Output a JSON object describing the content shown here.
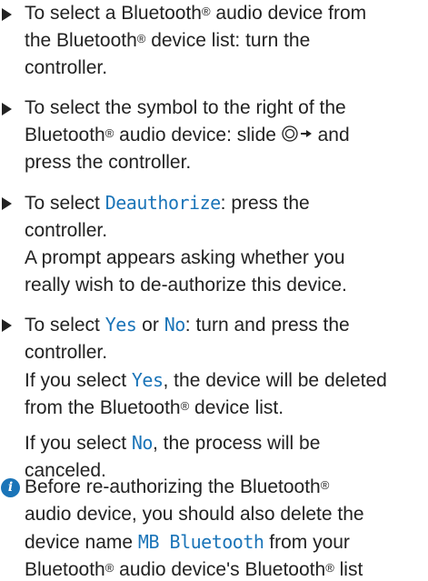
{
  "colors": {
    "text": "#222222",
    "highlight": "#1a74b8"
  },
  "icons": {
    "step_marker": "triangle-right-icon",
    "controller_slide": "controller-slide-right-icon",
    "info": "info-icon"
  },
  "steps": [
    {
      "lines": [
        [
          "To select a Bluetooth",
          "®",
          " audio device from"
        ],
        [
          "the Bluetooth",
          "®",
          " device list: turn the"
        ],
        [
          "controller."
        ]
      ]
    },
    {
      "l1": "To select the symbol to the right of the",
      "l2a": "Bluetooth",
      "l2sup": "®",
      "l2b": " audio device: slide ",
      "l2c": " and",
      "l3": "press the controller."
    },
    {
      "l1a": "To select ",
      "l1hl": "Deauthorize",
      "l1b": ": press the",
      "l2": "controller.",
      "r1": "A prompt appears asking whether you",
      "r2": "really wish to de-authorize this device."
    },
    {
      "l1a": "To select ",
      "l1hl1": "Yes",
      "l1b": " or ",
      "l1hl2": "No",
      "l1c": ": turn and press the",
      "l2": "controller.",
      "r1a": "If you select ",
      "r1hl": "Yes",
      "r1b": ", the device will be deleted",
      "r2a": "from the Bluetooth",
      "r2sup": "®",
      "r2b": " device list.",
      "r3a": "If you select ",
      "r3hl": "No",
      "r3b": ", the process will be",
      "r4": "canceled."
    }
  ],
  "info": {
    "l1a": "Before re-authorizing the Bluetooth",
    "l1sup": "®",
    "l2": "audio device, you should also delete the",
    "l3a": "device name ",
    "l3hl": "MB Bluetooth",
    "l3b": " from your",
    "l4a": "Bluetooth",
    "l4sup": "®",
    "l4b": " audio device's Bluetooth",
    "l4sup2": "®",
    "l4c": " list"
  }
}
